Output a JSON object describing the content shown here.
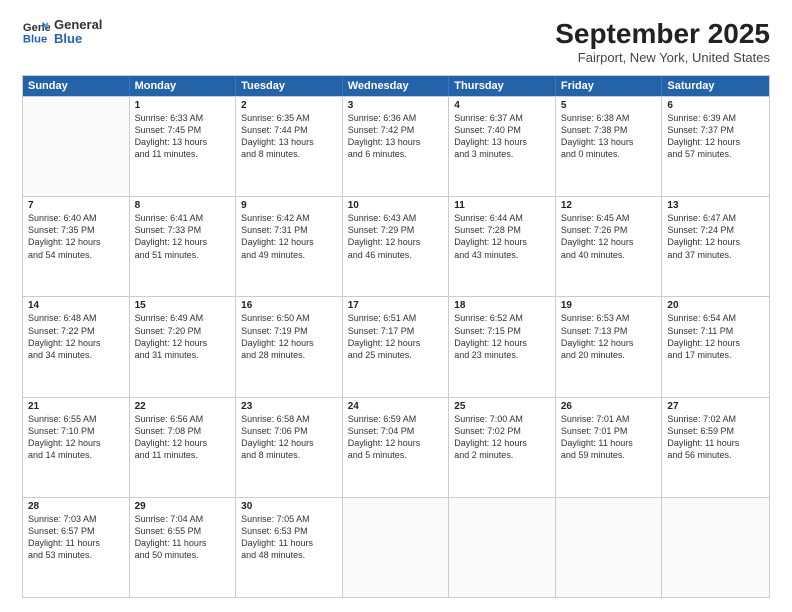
{
  "header": {
    "logo_general": "General",
    "logo_blue": "Blue",
    "title": "September 2025",
    "subtitle": "Fairport, New York, United States"
  },
  "weekdays": [
    "Sunday",
    "Monday",
    "Tuesday",
    "Wednesday",
    "Thursday",
    "Friday",
    "Saturday"
  ],
  "rows": [
    [
      {
        "day": "",
        "lines": []
      },
      {
        "day": "1",
        "lines": [
          "Sunrise: 6:33 AM",
          "Sunset: 7:45 PM",
          "Daylight: 13 hours",
          "and 11 minutes."
        ]
      },
      {
        "day": "2",
        "lines": [
          "Sunrise: 6:35 AM",
          "Sunset: 7:44 PM",
          "Daylight: 13 hours",
          "and 8 minutes."
        ]
      },
      {
        "day": "3",
        "lines": [
          "Sunrise: 6:36 AM",
          "Sunset: 7:42 PM",
          "Daylight: 13 hours",
          "and 6 minutes."
        ]
      },
      {
        "day": "4",
        "lines": [
          "Sunrise: 6:37 AM",
          "Sunset: 7:40 PM",
          "Daylight: 13 hours",
          "and 3 minutes."
        ]
      },
      {
        "day": "5",
        "lines": [
          "Sunrise: 6:38 AM",
          "Sunset: 7:38 PM",
          "Daylight: 13 hours",
          "and 0 minutes."
        ]
      },
      {
        "day": "6",
        "lines": [
          "Sunrise: 6:39 AM",
          "Sunset: 7:37 PM",
          "Daylight: 12 hours",
          "and 57 minutes."
        ]
      }
    ],
    [
      {
        "day": "7",
        "lines": [
          "Sunrise: 6:40 AM",
          "Sunset: 7:35 PM",
          "Daylight: 12 hours",
          "and 54 minutes."
        ]
      },
      {
        "day": "8",
        "lines": [
          "Sunrise: 6:41 AM",
          "Sunset: 7:33 PM",
          "Daylight: 12 hours",
          "and 51 minutes."
        ]
      },
      {
        "day": "9",
        "lines": [
          "Sunrise: 6:42 AM",
          "Sunset: 7:31 PM",
          "Daylight: 12 hours",
          "and 49 minutes."
        ]
      },
      {
        "day": "10",
        "lines": [
          "Sunrise: 6:43 AM",
          "Sunset: 7:29 PM",
          "Daylight: 12 hours",
          "and 46 minutes."
        ]
      },
      {
        "day": "11",
        "lines": [
          "Sunrise: 6:44 AM",
          "Sunset: 7:28 PM",
          "Daylight: 12 hours",
          "and 43 minutes."
        ]
      },
      {
        "day": "12",
        "lines": [
          "Sunrise: 6:45 AM",
          "Sunset: 7:26 PM",
          "Daylight: 12 hours",
          "and 40 minutes."
        ]
      },
      {
        "day": "13",
        "lines": [
          "Sunrise: 6:47 AM",
          "Sunset: 7:24 PM",
          "Daylight: 12 hours",
          "and 37 minutes."
        ]
      }
    ],
    [
      {
        "day": "14",
        "lines": [
          "Sunrise: 6:48 AM",
          "Sunset: 7:22 PM",
          "Daylight: 12 hours",
          "and 34 minutes."
        ]
      },
      {
        "day": "15",
        "lines": [
          "Sunrise: 6:49 AM",
          "Sunset: 7:20 PM",
          "Daylight: 12 hours",
          "and 31 minutes."
        ]
      },
      {
        "day": "16",
        "lines": [
          "Sunrise: 6:50 AM",
          "Sunset: 7:19 PM",
          "Daylight: 12 hours",
          "and 28 minutes."
        ]
      },
      {
        "day": "17",
        "lines": [
          "Sunrise: 6:51 AM",
          "Sunset: 7:17 PM",
          "Daylight: 12 hours",
          "and 25 minutes."
        ]
      },
      {
        "day": "18",
        "lines": [
          "Sunrise: 6:52 AM",
          "Sunset: 7:15 PM",
          "Daylight: 12 hours",
          "and 23 minutes."
        ]
      },
      {
        "day": "19",
        "lines": [
          "Sunrise: 6:53 AM",
          "Sunset: 7:13 PM",
          "Daylight: 12 hours",
          "and 20 minutes."
        ]
      },
      {
        "day": "20",
        "lines": [
          "Sunrise: 6:54 AM",
          "Sunset: 7:11 PM",
          "Daylight: 12 hours",
          "and 17 minutes."
        ]
      }
    ],
    [
      {
        "day": "21",
        "lines": [
          "Sunrise: 6:55 AM",
          "Sunset: 7:10 PM",
          "Daylight: 12 hours",
          "and 14 minutes."
        ]
      },
      {
        "day": "22",
        "lines": [
          "Sunrise: 6:56 AM",
          "Sunset: 7:08 PM",
          "Daylight: 12 hours",
          "and 11 minutes."
        ]
      },
      {
        "day": "23",
        "lines": [
          "Sunrise: 6:58 AM",
          "Sunset: 7:06 PM",
          "Daylight: 12 hours",
          "and 8 minutes."
        ]
      },
      {
        "day": "24",
        "lines": [
          "Sunrise: 6:59 AM",
          "Sunset: 7:04 PM",
          "Daylight: 12 hours",
          "and 5 minutes."
        ]
      },
      {
        "day": "25",
        "lines": [
          "Sunrise: 7:00 AM",
          "Sunset: 7:02 PM",
          "Daylight: 12 hours",
          "and 2 minutes."
        ]
      },
      {
        "day": "26",
        "lines": [
          "Sunrise: 7:01 AM",
          "Sunset: 7:01 PM",
          "Daylight: 11 hours",
          "and 59 minutes."
        ]
      },
      {
        "day": "27",
        "lines": [
          "Sunrise: 7:02 AM",
          "Sunset: 6:59 PM",
          "Daylight: 11 hours",
          "and 56 minutes."
        ]
      }
    ],
    [
      {
        "day": "28",
        "lines": [
          "Sunrise: 7:03 AM",
          "Sunset: 6:57 PM",
          "Daylight: 11 hours",
          "and 53 minutes."
        ]
      },
      {
        "day": "29",
        "lines": [
          "Sunrise: 7:04 AM",
          "Sunset: 6:55 PM",
          "Daylight: 11 hours",
          "and 50 minutes."
        ]
      },
      {
        "day": "30",
        "lines": [
          "Sunrise: 7:05 AM",
          "Sunset: 6:53 PM",
          "Daylight: 11 hours",
          "and 48 minutes."
        ]
      },
      {
        "day": "",
        "lines": []
      },
      {
        "day": "",
        "lines": []
      },
      {
        "day": "",
        "lines": []
      },
      {
        "day": "",
        "lines": []
      }
    ]
  ]
}
